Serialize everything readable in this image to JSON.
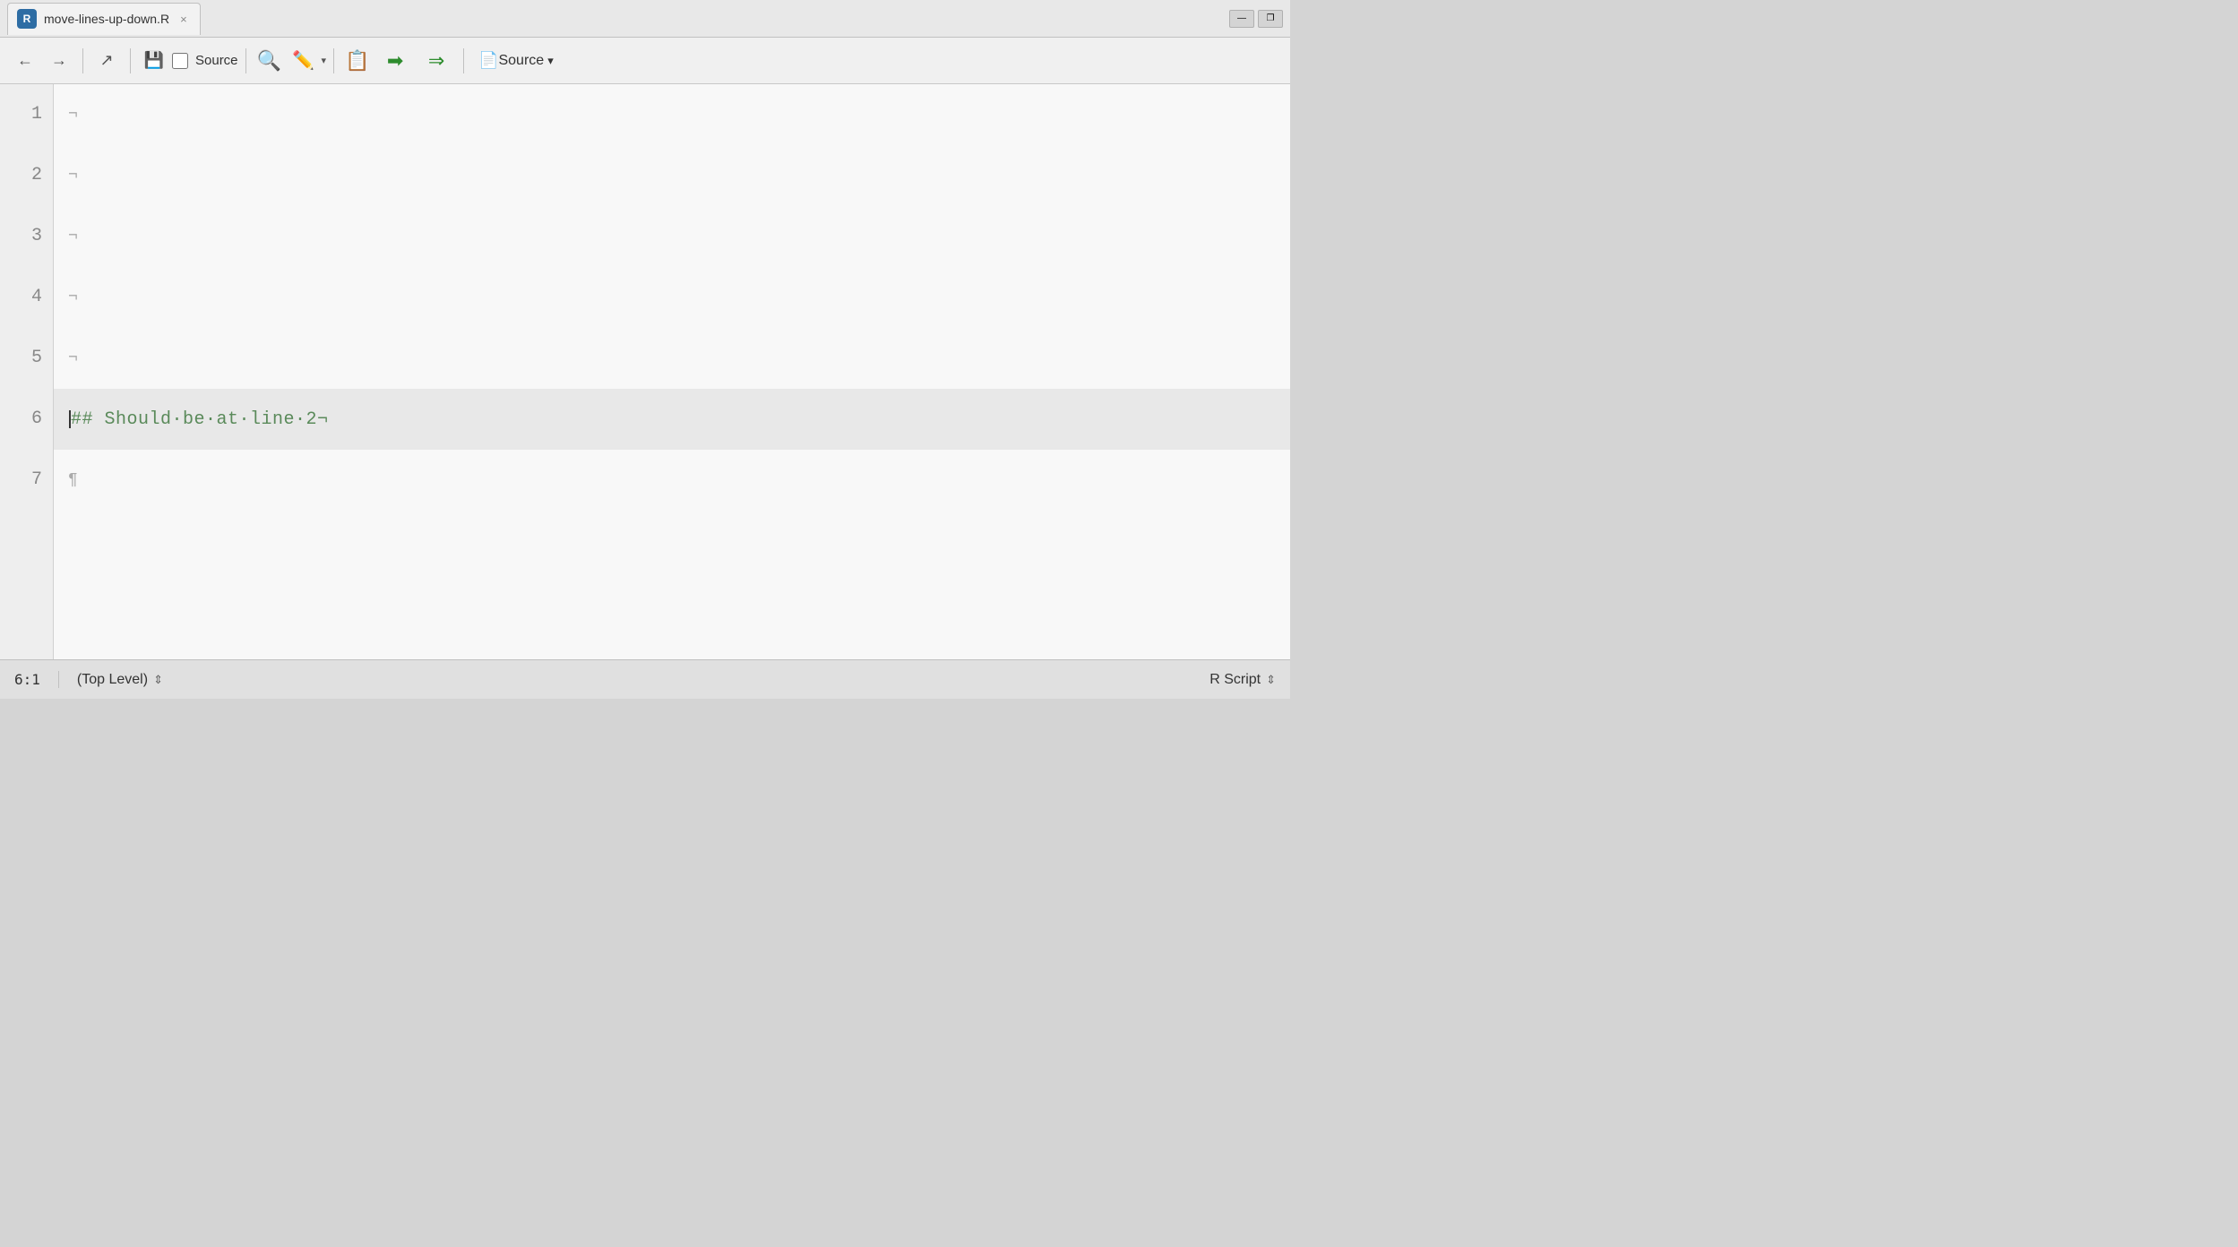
{
  "tab": {
    "filename": "move-lines-up-down.R",
    "r_icon_label": "R",
    "close_label": "×"
  },
  "window_buttons": {
    "minimize_label": "—",
    "maximize_label": "❐"
  },
  "toolbar": {
    "back_icon": "←",
    "forward_icon": "→",
    "external_icon": "↗",
    "save_icon": "💾",
    "source_checkbox_label": "Source",
    "search_icon": "🔍",
    "wand_icon": "🪄",
    "dropdown_arrow": "▾",
    "notebook_icon": "📋",
    "run_icon": "➡",
    "run_arrows_icon": "⇒",
    "source_label": "Source",
    "source_arrow": "▾"
  },
  "editor": {
    "lines": [
      {
        "number": "1",
        "content": "¬",
        "type": "pilcrow",
        "active": false
      },
      {
        "number": "2",
        "content": "¬",
        "type": "pilcrow",
        "active": false
      },
      {
        "number": "3",
        "content": "¬",
        "type": "pilcrow",
        "active": false
      },
      {
        "number": "4",
        "content": "¬",
        "type": "pilcrow",
        "active": false
      },
      {
        "number": "5",
        "content": "¬",
        "type": "pilcrow",
        "active": false
      },
      {
        "number": "6",
        "content": "## Should be at line 2¬",
        "type": "comment",
        "active": true
      },
      {
        "number": "7",
        "content": "¶",
        "type": "para",
        "active": false
      }
    ]
  },
  "status_bar": {
    "position": "6:1",
    "scope": "(Top Level)",
    "scope_arrow": "⇕",
    "filetype": "R Script",
    "filetype_arrow": "⇕"
  }
}
